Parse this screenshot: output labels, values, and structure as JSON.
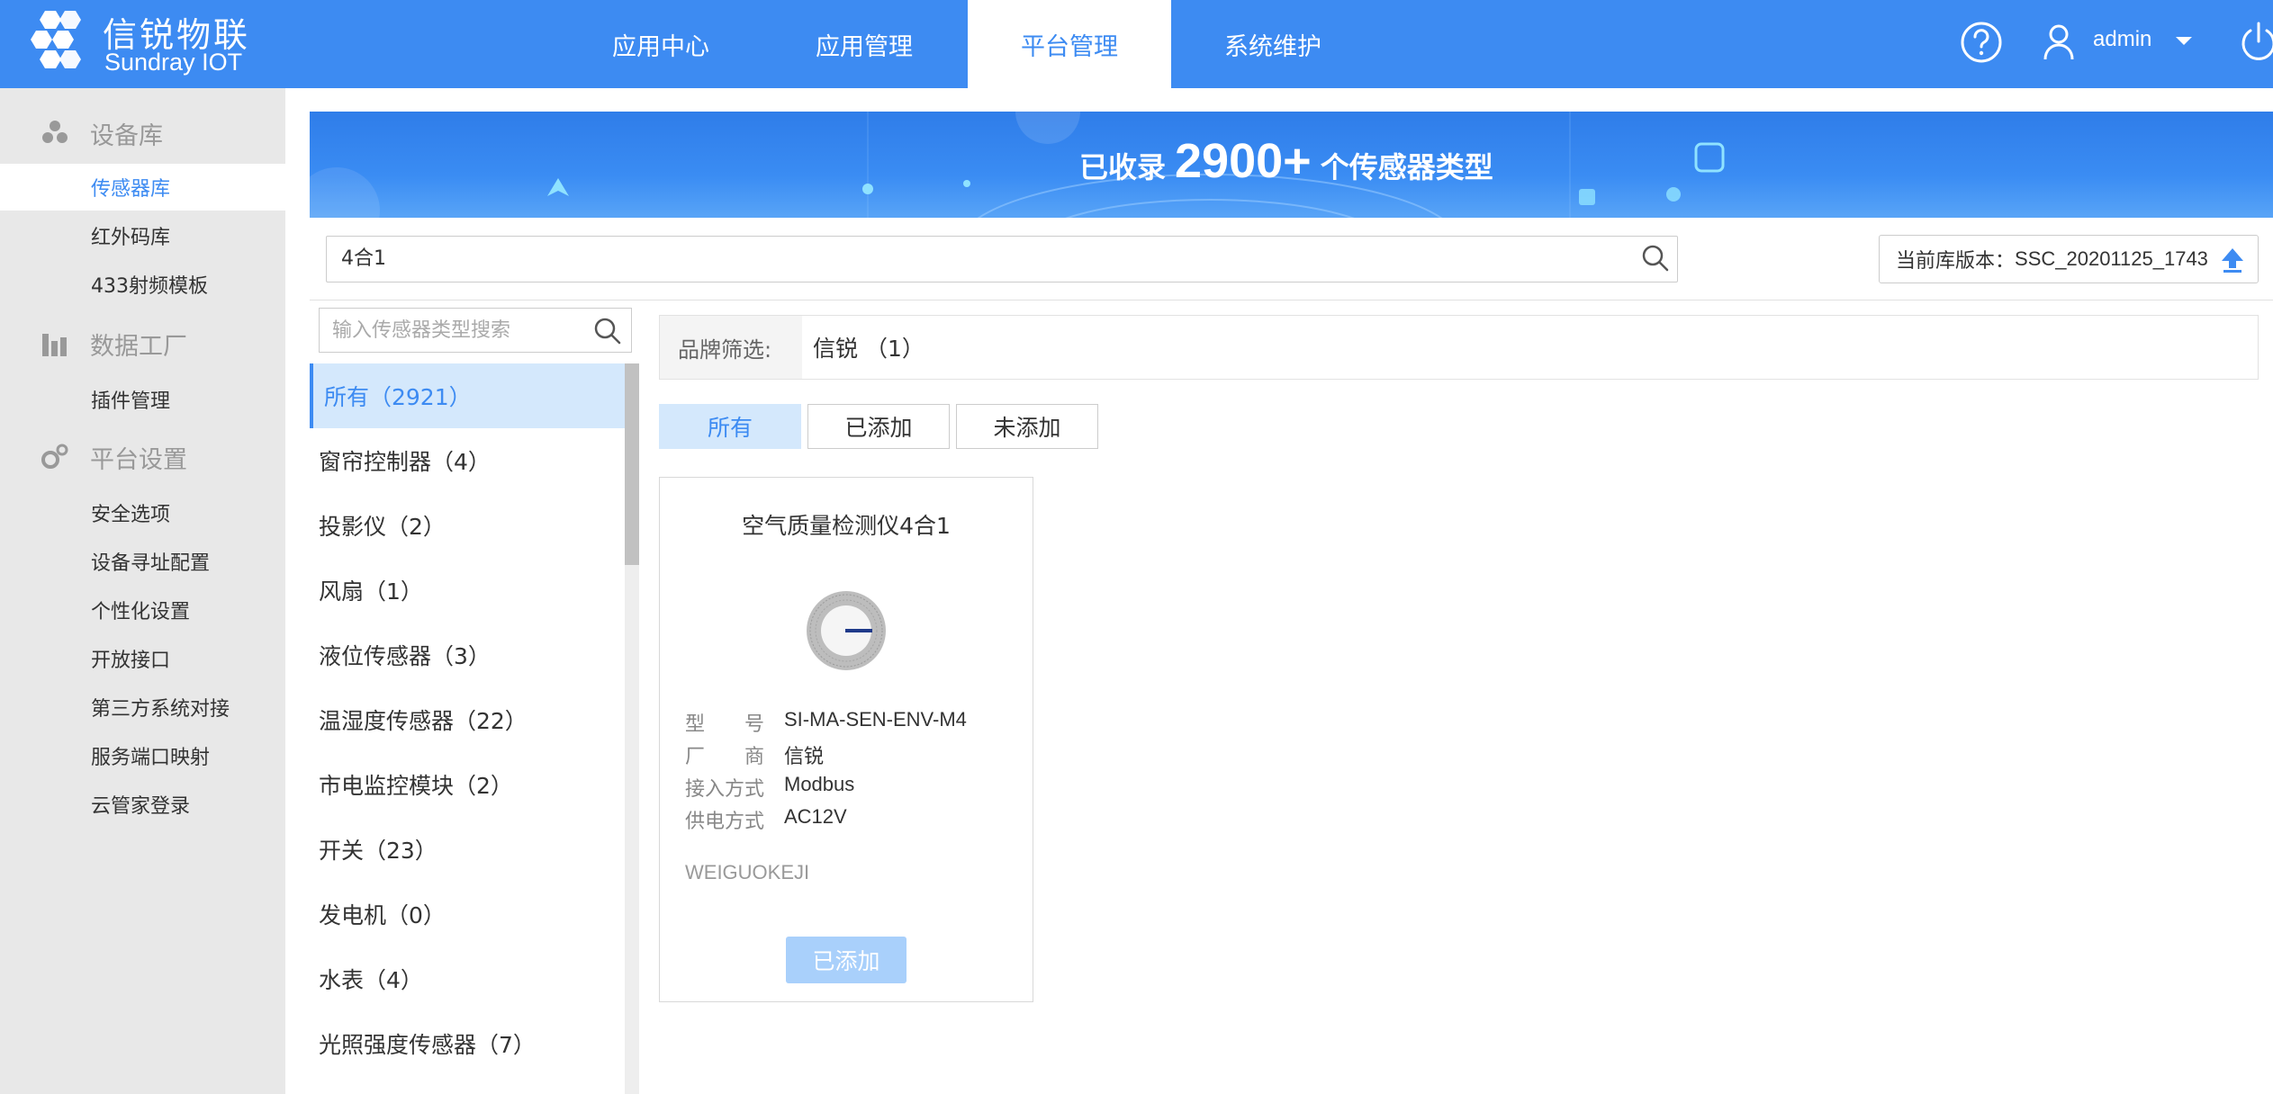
{
  "app": {
    "logo_cn": "信锐物联",
    "logo_en": "Sundray IOT"
  },
  "nav": {
    "tabs": [
      {
        "label": "应用中心"
      },
      {
        "label": "应用管理"
      },
      {
        "label": "平台管理"
      },
      {
        "label": "系统维护"
      }
    ],
    "active_tab": "平台管理",
    "user": "admin",
    "help_icon": "help-circle-icon",
    "user_icon": "user-icon",
    "power_icon": "power-icon"
  },
  "sidebar": {
    "groups": [
      {
        "label": "设备库",
        "icon": "device-library-icon",
        "items": [
          {
            "label": "传感器库"
          },
          {
            "label": "红外码库"
          },
          {
            "label": "433射频模板"
          }
        ]
      },
      {
        "label": "数据工厂",
        "icon": "data-factory-icon",
        "items": [
          {
            "label": "插件管理"
          }
        ]
      },
      {
        "label": "平台设置",
        "icon": "settings-gear-icon",
        "items": [
          {
            "label": "安全选项"
          },
          {
            "label": "设备寻址配置"
          },
          {
            "label": "个性化设置"
          },
          {
            "label": "开放接口"
          },
          {
            "label": "第三方系统对接"
          },
          {
            "label": "服务端口映射"
          },
          {
            "label": "云管家登录"
          }
        ]
      }
    ],
    "active_item": "传感器库"
  },
  "banner": {
    "prefix": "已收录",
    "number": "2900+",
    "suffix": "个传感器类型"
  },
  "search": {
    "value": "4合1"
  },
  "version": {
    "label": "当前库版本：",
    "value": "SSC_20201125_1743"
  },
  "categories": {
    "placeholder": "输入传感器类型搜索",
    "items": [
      {
        "label": "所有（2921）"
      },
      {
        "label": "窗帘控制器（4）"
      },
      {
        "label": "投影仪（2）"
      },
      {
        "label": "风扇（1）"
      },
      {
        "label": "液位传感器（3）"
      },
      {
        "label": "温湿度传感器（22）"
      },
      {
        "label": "市电监控模块（2）"
      },
      {
        "label": "开关（23）"
      },
      {
        "label": "发电机（0）"
      },
      {
        "label": "水表（4）"
      },
      {
        "label": "光照强度传感器（7）"
      }
    ]
  },
  "brand_filter": {
    "label": "品牌筛选:",
    "value": "信锐 （1）"
  },
  "status_filters": [
    {
      "label": "所有"
    },
    {
      "label": "已添加"
    },
    {
      "label": "未添加"
    }
  ],
  "device": {
    "title": "空气质量检测仪4合1",
    "specs": [
      {
        "key": "型　　号",
        "value": "SI-MA-SEN-ENV-M4"
      },
      {
        "key": "厂　　商",
        "value": "信锐"
      },
      {
        "key": "接入方式",
        "value": "Modbus"
      },
      {
        "key": "供电方式",
        "value": "AC12V"
      }
    ],
    "brand": "WEIGUOKEJI",
    "button": "已添加"
  },
  "colors": {
    "primary": "#3d8bf2",
    "active_bg": "#d4e8fc",
    "disabled_button": "#a9d0fb"
  }
}
